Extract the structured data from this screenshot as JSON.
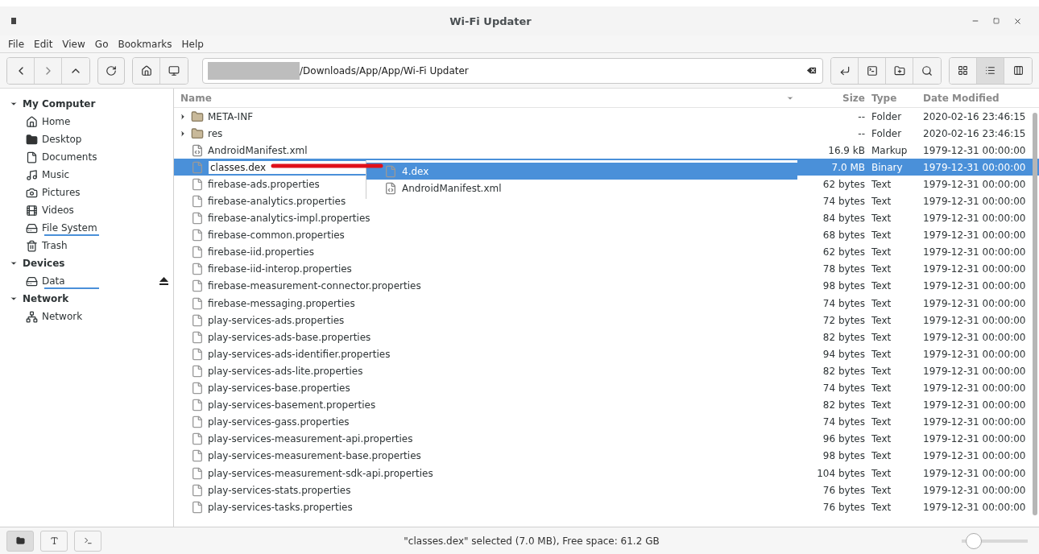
{
  "window": {
    "title": "Wi-Fi Updater"
  },
  "menu": [
    "File",
    "Edit",
    "View",
    "Go",
    "Bookmarks",
    "Help"
  ],
  "location": {
    "value": "/Downloads/App/App/Wi-Fi Updater"
  },
  "view_buttons": [
    {
      "kind": "icons",
      "selected": false
    },
    {
      "kind": "list",
      "selected": true
    },
    {
      "kind": "compact",
      "selected": false
    }
  ],
  "sidebar": [
    {
      "label": "My Computer",
      "expanded": true,
      "children": [
        {
          "label": "Home",
          "kind": "home"
        },
        {
          "label": "Desktop",
          "kind": "desktop"
        },
        {
          "label": "Documents",
          "kind": "documents"
        },
        {
          "label": "Music",
          "kind": "music"
        },
        {
          "label": "Pictures",
          "kind": "pictures"
        },
        {
          "label": "Videos",
          "kind": "videos"
        },
        {
          "label": "File System",
          "kind": "drive",
          "mounted": true
        },
        {
          "label": "Trash",
          "kind": "trash"
        }
      ]
    },
    {
      "label": "Devices",
      "expanded": true,
      "children": [
        {
          "label": "Data",
          "kind": "drive",
          "mounted": true,
          "ejectable": true
        }
      ]
    },
    {
      "label": "Network",
      "expanded": true,
      "children": [
        {
          "label": "Network",
          "kind": "network"
        }
      ]
    }
  ],
  "table": {
    "columns": [
      "Name",
      "Size",
      "Type",
      "Date Modified"
    ],
    "rows": [
      {
        "kind": "folder",
        "name": "META-INF",
        "size": "--",
        "type": "Folder",
        "modified": "2020-02-16 23:46:15",
        "selected": false
      },
      {
        "kind": "folder",
        "name": "res",
        "size": "--",
        "type": "Folder",
        "modified": "2020-02-16 23:46:15",
        "selected": false
      },
      {
        "kind": "xml",
        "name": "AndroidManifest.xml",
        "size": "16.9 kB",
        "type": "Markup",
        "modified": "1979-12-31 00:00:00",
        "selected": false
      },
      {
        "kind": "file",
        "name": "classes.dex",
        "size": "7.0 MB",
        "type": "Binary",
        "modified": "1979-12-31 00:00:00",
        "selected": true,
        "editing": true
      },
      {
        "kind": "file",
        "name": "firebase-ads.properties",
        "size": "62 bytes",
        "type": "Text",
        "modified": "1979-12-31 00:00:00",
        "selected": false
      },
      {
        "kind": "file",
        "name": "firebase-analytics.properties",
        "size": "74 bytes",
        "type": "Text",
        "modified": "1979-12-31 00:00:00",
        "selected": false
      },
      {
        "kind": "file",
        "name": "firebase-analytics-impl.properties",
        "size": "84 bytes",
        "type": "Text",
        "modified": "1979-12-31 00:00:00",
        "selected": false
      },
      {
        "kind": "file",
        "name": "firebase-common.properties",
        "size": "68 bytes",
        "type": "Text",
        "modified": "1979-12-31 00:00:00",
        "selected": false
      },
      {
        "kind": "file",
        "name": "firebase-iid.properties",
        "size": "62 bytes",
        "type": "Text",
        "modified": "1979-12-31 00:00:00",
        "selected": false
      },
      {
        "kind": "file",
        "name": "firebase-iid-interop.properties",
        "size": "78 bytes",
        "type": "Text",
        "modified": "1979-12-31 00:00:00",
        "selected": false
      },
      {
        "kind": "file",
        "name": "firebase-measurement-connector.properties",
        "size": "98 bytes",
        "type": "Text",
        "modified": "1979-12-31 00:00:00",
        "selected": false
      },
      {
        "kind": "file",
        "name": "firebase-messaging.properties",
        "size": "74 bytes",
        "type": "Text",
        "modified": "1979-12-31 00:00:00",
        "selected": false
      },
      {
        "kind": "file",
        "name": "play-services-ads.properties",
        "size": "72 bytes",
        "type": "Text",
        "modified": "1979-12-31 00:00:00",
        "selected": false
      },
      {
        "kind": "file",
        "name": "play-services-ads-base.properties",
        "size": "82 bytes",
        "type": "Text",
        "modified": "1979-12-31 00:00:00",
        "selected": false
      },
      {
        "kind": "file",
        "name": "play-services-ads-identifier.properties",
        "size": "94 bytes",
        "type": "Text",
        "modified": "1979-12-31 00:00:00",
        "selected": false
      },
      {
        "kind": "file",
        "name": "play-services-ads-lite.properties",
        "size": "82 bytes",
        "type": "Text",
        "modified": "1979-12-31 00:00:00",
        "selected": false
      },
      {
        "kind": "file",
        "name": "play-services-base.properties",
        "size": "74 bytes",
        "type": "Text",
        "modified": "1979-12-31 00:00:00",
        "selected": false
      },
      {
        "kind": "file",
        "name": "play-services-basement.properties",
        "size": "82 bytes",
        "type": "Text",
        "modified": "1979-12-31 00:00:00",
        "selected": false
      },
      {
        "kind": "file",
        "name": "play-services-gass.properties",
        "size": "74 bytes",
        "type": "Text",
        "modified": "1979-12-31 00:00:00",
        "selected": false
      },
      {
        "kind": "file",
        "name": "play-services-measurement-api.properties",
        "size": "96 bytes",
        "type": "Text",
        "modified": "1979-12-31 00:00:00",
        "selected": false
      },
      {
        "kind": "file",
        "name": "play-services-measurement-base.properties",
        "size": "98 bytes",
        "type": "Text",
        "modified": "1979-12-31 00:00:00",
        "selected": false
      },
      {
        "kind": "file",
        "name": "play-services-measurement-sdk-api.properties",
        "size": "104 bytes",
        "type": "Text",
        "modified": "1979-12-31 00:00:00",
        "selected": false
      },
      {
        "kind": "file",
        "name": "play-services-stats.properties",
        "size": "76 bytes",
        "type": "Text",
        "modified": "1979-12-31 00:00:00",
        "selected": false
      },
      {
        "kind": "file",
        "name": "play-services-tasks.properties",
        "size": "76 bytes",
        "type": "Text",
        "modified": "1979-12-31 00:00:00",
        "selected": false
      }
    ]
  },
  "popup": {
    "items": [
      {
        "kind": "file",
        "name": "4.dex",
        "selected": true
      },
      {
        "kind": "xml",
        "name": "AndroidManifest.xml",
        "selected": false
      }
    ]
  },
  "status_bar": {
    "text": "\"classes.dex\" selected (7.0 MB), Free space: 61.2 GB",
    "zoom": {
      "level": 0.08
    }
  }
}
